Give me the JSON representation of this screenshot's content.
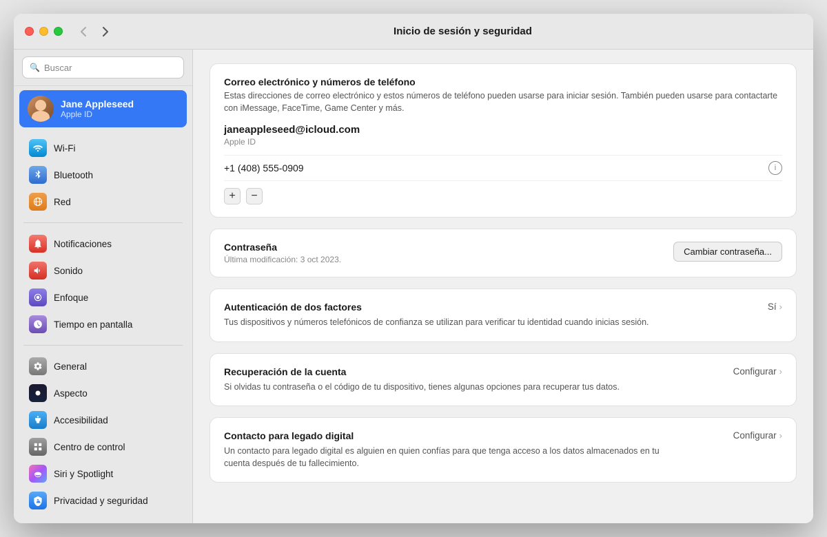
{
  "titlebar": {
    "title": "Inicio de sesión y seguridad",
    "nav_back": "‹",
    "nav_forward": "›"
  },
  "sidebar": {
    "search_placeholder": "Buscar",
    "user": {
      "name": "Jane Appleseed",
      "subtitle": "Apple ID"
    },
    "sections": [
      {
        "items": [
          {
            "id": "wifi",
            "label": "Wi-Fi",
            "icon_class": "icon-wifi",
            "icon": "📶"
          },
          {
            "id": "bluetooth",
            "label": "Bluetooth",
            "icon_class": "icon-bt",
            "icon": "⌥"
          },
          {
            "id": "network",
            "label": "Red",
            "icon_class": "icon-network",
            "icon": "🌐"
          }
        ]
      },
      {
        "items": [
          {
            "id": "notifications",
            "label": "Notificaciones",
            "icon_class": "icon-notif",
            "icon": "🔔"
          },
          {
            "id": "sound",
            "label": "Sonido",
            "icon_class": "icon-sound",
            "icon": "🔊"
          },
          {
            "id": "focus",
            "label": "Enfoque",
            "icon_class": "icon-focus",
            "icon": "🌙"
          },
          {
            "id": "screentime",
            "label": "Tiempo en pantalla",
            "icon_class": "icon-screen",
            "icon": "⏱"
          }
        ]
      },
      {
        "items": [
          {
            "id": "general",
            "label": "General",
            "icon_class": "icon-general",
            "icon": "⚙"
          },
          {
            "id": "appearance",
            "label": "Aspecto",
            "icon_class": "icon-appear",
            "icon": "🖌"
          },
          {
            "id": "accessibility",
            "label": "Accesibilidad",
            "icon_class": "icon-access",
            "icon": "♿"
          },
          {
            "id": "control",
            "label": "Centro de control",
            "icon_class": "icon-control",
            "icon": "◉"
          },
          {
            "id": "siri",
            "label": "Siri y Spotlight",
            "icon_class": "icon-siri",
            "icon": "✦"
          },
          {
            "id": "privacy",
            "label": "Privacidad y seguridad",
            "icon_class": "icon-privacy",
            "icon": "✋"
          }
        ]
      }
    ]
  },
  "content": {
    "email_card": {
      "title": "Correo electrónico y números de teléfono",
      "desc": "Estas direcciones de correo electrónico y estos números de teléfono pueden usarse para iniciar sesión. También pueden usarse para contactarte con iMessage, FaceTime, Game Center y más.",
      "email": "janeappleseed@icloud.com",
      "email_label": "Apple ID",
      "phone": "+1 (408) 555-0909",
      "add_label": "+",
      "remove_label": "−"
    },
    "password_card": {
      "title": "Contraseña",
      "date": "Última modificación: 3 oct 2023.",
      "button": "Cambiar contraseña..."
    },
    "twofa_card": {
      "title": "Autenticación de dos factores",
      "desc": "Tus dispositivos y números telefónicos de confianza se utilizan para verificar tu identidad cuando inicias sesión.",
      "status": "Sí"
    },
    "recovery_card": {
      "title": "Recuperación de la cuenta",
      "desc": "Si olvidas tu contraseña o el código de tu dispositivo, tienes algunas opciones para recuperar tus datos.",
      "action": "Configurar"
    },
    "legacy_card": {
      "title": "Contacto para legado digital",
      "desc": "Un contacto para legado digital es alguien en quien confías para que tenga acceso a los datos almacenados en tu cuenta después de tu fallecimiento.",
      "action": "Configurar"
    }
  }
}
